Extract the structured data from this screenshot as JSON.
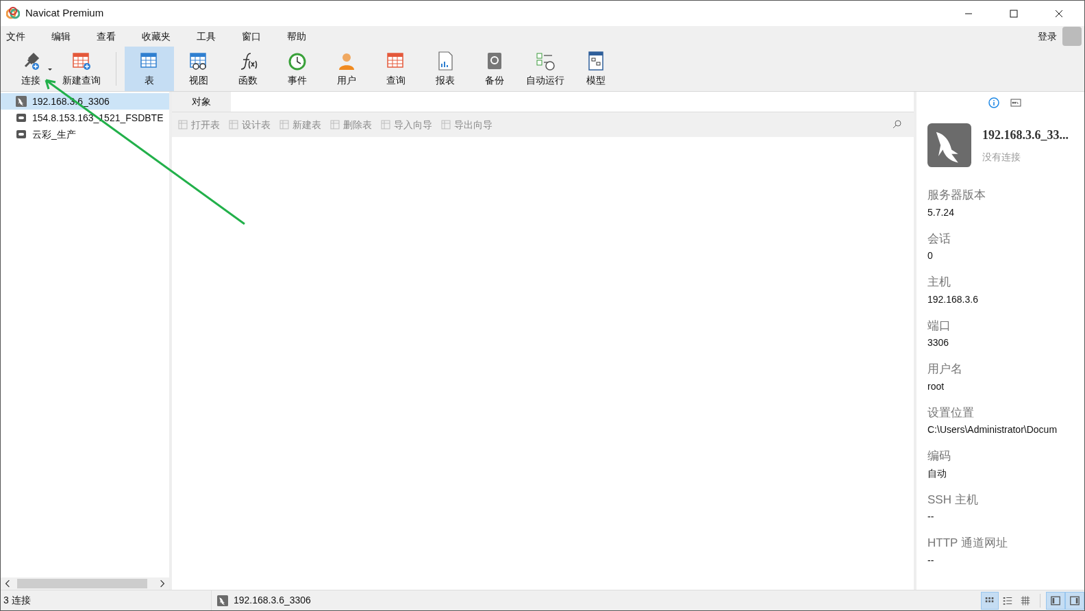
{
  "window": {
    "title": "Navicat Premium"
  },
  "menu": [
    "文件",
    "编辑",
    "查看",
    "收藏夹",
    "工具",
    "窗口",
    "帮助"
  ],
  "login": "登录",
  "toolbar": [
    {
      "label": "连接",
      "kind": "connect",
      "selected": false
    },
    {
      "label": "新建查询",
      "kind": "newquery",
      "selected": false
    },
    {
      "label": "表",
      "kind": "table",
      "selected": true
    },
    {
      "label": "视图",
      "kind": "view",
      "selected": false
    },
    {
      "label": "函数",
      "kind": "function",
      "selected": false
    },
    {
      "label": "事件",
      "kind": "event",
      "selected": false
    },
    {
      "label": "用户",
      "kind": "user",
      "selected": false
    },
    {
      "label": "查询",
      "kind": "query",
      "selected": false
    },
    {
      "label": "报表",
      "kind": "report",
      "selected": false
    },
    {
      "label": "备份",
      "kind": "backup",
      "selected": false
    },
    {
      "label": "自动运行",
      "kind": "schedule",
      "selected": false
    },
    {
      "label": "模型",
      "kind": "model",
      "selected": false
    }
  ],
  "connections": [
    {
      "name": "192.168.3.6_3306",
      "kind": "mysql",
      "selected": true
    },
    {
      "name": "154.8.153.163_1521_FSDBTE",
      "kind": "oracle",
      "selected": false
    },
    {
      "name": "云彩_生产",
      "kind": "oracle",
      "selected": false
    }
  ],
  "tabs": [
    {
      "label": "对象",
      "selected": true
    }
  ],
  "object_actions": [
    {
      "label": "打开表",
      "disabled": true
    },
    {
      "label": "设计表",
      "disabled": true
    },
    {
      "label": "新建表",
      "disabled": true
    },
    {
      "label": "删除表",
      "disabled": true
    },
    {
      "label": "导入向导",
      "disabled": true
    },
    {
      "label": "导出向导",
      "disabled": true
    }
  ],
  "info": {
    "name": "192.168.3.6_33...",
    "status": "没有连接",
    "fields": [
      {
        "label": "服务器版本",
        "value": "5.7.24"
      },
      {
        "label": "会话",
        "value": "0"
      },
      {
        "label": "主机",
        "value": "192.168.3.6"
      },
      {
        "label": "端口",
        "value": "3306"
      },
      {
        "label": "用户名",
        "value": "root"
      },
      {
        "label": "设置位置",
        "value": "C:\\Users\\Administrator\\Docum"
      },
      {
        "label": "编码",
        "value": "自动"
      },
      {
        "label": "SSH 主机",
        "value": "--"
      },
      {
        "label": "HTTP 通道网址",
        "value": "--"
      }
    ]
  },
  "status_bar": {
    "count": "3 连接",
    "connection": "192.168.3.6_3306",
    "views": [
      {
        "kind": "icons",
        "selected": true
      },
      {
        "kind": "list",
        "selected": false
      },
      {
        "kind": "detail",
        "selected": false
      }
    ],
    "panels": [
      {
        "kind": "left",
        "selected": true
      },
      {
        "kind": "right",
        "selected": true
      }
    ]
  }
}
